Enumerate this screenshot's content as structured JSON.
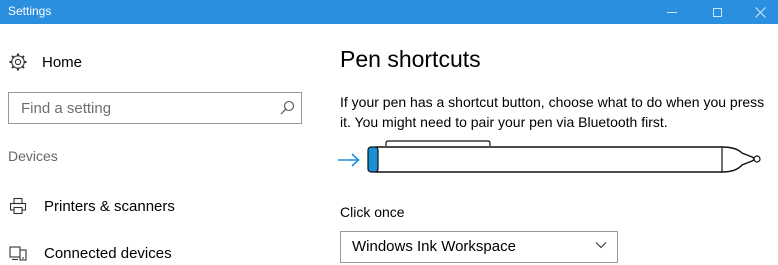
{
  "window": {
    "title": "Settings"
  },
  "sidebar": {
    "home_label": "Home",
    "search": {
      "placeholder": "Find a setting",
      "value": ""
    },
    "section_label": "Devices",
    "items": [
      {
        "label": "Printers & scanners",
        "icon": "printer-icon"
      },
      {
        "label": "Connected devices",
        "icon": "connected-devices-icon"
      }
    ]
  },
  "main": {
    "title": "Pen shortcuts",
    "description": "If your pen has a shortcut button, choose what to do when you press it. You might need to pair your pen via Bluetooth first.",
    "click_once": {
      "label": "Click once",
      "selected": "Windows Ink Workspace"
    }
  },
  "colors": {
    "titlebar": "#2b8fe0",
    "accent": "#1a8fd8"
  }
}
